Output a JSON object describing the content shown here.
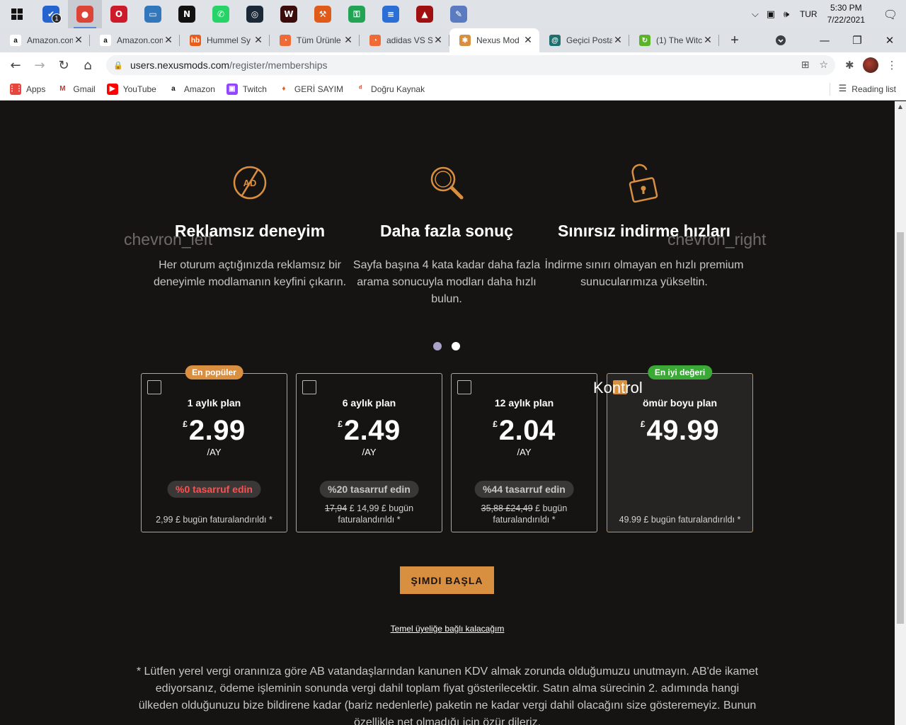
{
  "taskbar": {
    "apps": [
      {
        "name": "todo",
        "color": "#2564cf",
        "glyph": "✔",
        "badge": "1"
      },
      {
        "name": "chrome",
        "color": "#db4437",
        "glyph": "●",
        "active": true
      },
      {
        "name": "opera",
        "color": "#cc1b2a",
        "glyph": "O"
      },
      {
        "name": "pc",
        "color": "#3277bc",
        "glyph": "▭"
      },
      {
        "name": "notion",
        "color": "#111111",
        "glyph": "N"
      },
      {
        "name": "whatsapp",
        "color": "#25d366",
        "glyph": "✆"
      },
      {
        "name": "steam",
        "color": "#1b2838",
        "glyph": "◎"
      },
      {
        "name": "witcher",
        "color": "#3a0c0c",
        "glyph": "W"
      },
      {
        "name": "tool",
        "color": "#e05a1a",
        "glyph": "⚒"
      },
      {
        "name": "vpn",
        "color": "#23a455",
        "glyph": "⚿"
      },
      {
        "name": "docs",
        "color": "#2b6fd6",
        "glyph": "≡"
      },
      {
        "name": "game",
        "color": "#a01010",
        "glyph": "▲"
      },
      {
        "name": "paint",
        "color": "#5a7bc0",
        "glyph": "✎"
      }
    ],
    "language": "TUR",
    "time": "5:30 PM",
    "date": "7/22/2021"
  },
  "tabs": [
    {
      "title": "Amazon.com",
      "fav_color": "#ffffff",
      "fav_text": "a",
      "fav_fg": "#111"
    },
    {
      "title": "Amazon.com",
      "fav_color": "#ffffff",
      "fav_text": "a",
      "fav_fg": "#111"
    },
    {
      "title": "Hummel Sy",
      "fav_color": "#e85d1c",
      "fav_text": "hb",
      "fav_fg": "#fff"
    },
    {
      "title": "Tüm Ürünle",
      "fav_color": "#f06a35",
      "fav_text": "◔",
      "fav_fg": "#fff"
    },
    {
      "title": "adidas VS S",
      "fav_color": "#f06a35",
      "fav_text": "◔",
      "fav_fg": "#fff"
    },
    {
      "title": "Nexus Mod",
      "fav_color": "#d98f40",
      "fav_text": "✱",
      "fav_fg": "#fff",
      "active": true
    },
    {
      "title": "Geçici Posta",
      "fav_color": "#1f6f6f",
      "fav_text": "@",
      "fav_fg": "#fff"
    },
    {
      "title": "(1) The Witc",
      "fav_color": "#5bb32a",
      "fav_text": "↻",
      "fav_fg": "#fff"
    }
  ],
  "address": {
    "host": "users.nexusmods.com",
    "path": "/register/memberships"
  },
  "bookmarks": [
    {
      "label": "Apps",
      "color": "#e8453c",
      "glyph": "⋮⋮"
    },
    {
      "label": "Gmail",
      "color": "#ffffff",
      "glyph": "M",
      "fg": "#d93025"
    },
    {
      "label": "YouTube",
      "color": "#ff0000",
      "glyph": "▶"
    },
    {
      "label": "Amazon",
      "color": "#ffffff",
      "glyph": "a",
      "fg": "#111"
    },
    {
      "label": "Twitch",
      "color": "#9146ff",
      "glyph": "▣"
    },
    {
      "label": "GERİ SAYIM",
      "color": "#ffffff",
      "glyph": "♦",
      "fg": "#e85d1c"
    },
    {
      "label": "Doğru Kaynak",
      "color": "#ffffff",
      "glyph": "ᵈ",
      "fg": "#c0392b"
    }
  ],
  "reading_list": "Reading list",
  "carousel": {
    "prev": "chevron_left",
    "next": "chevron_right",
    "features": [
      {
        "icon": "no-ads-icon",
        "title": "Reklamsız deneyim",
        "text": "Her oturum açtığınızda reklamsız bir deneyimle modlamanın keyfini çıkarın."
      },
      {
        "icon": "search-icon",
        "title": "Daha fazla sonuç",
        "text": "Sayfa başına 4 kata kadar daha fazla arama sonucuyla modları daha hızlı bulun."
      },
      {
        "icon": "unlock-icon",
        "title": "Sınırsız indirme hızları",
        "text": "İndirme sınırı olmayan en hızlı premium sunucularımıza yükseltin."
      }
    ],
    "active_dot": 0,
    "dot_count": 2
  },
  "plans": [
    {
      "badge": "En popüler",
      "badge_color": "#d98f40",
      "name": "1 aylık plan",
      "currency": "£",
      "price": "2.99",
      "period": "/AY",
      "save": "%0 tasarruf edin",
      "save_color": "#ff4f4f",
      "old": "",
      "billed": "2,99 £ bugün faturalandırıldı *",
      "checked": false
    },
    {
      "badge": "",
      "name": "6 aylık plan",
      "currency": "£",
      "price": "2.49",
      "period": "/AY",
      "save": "%20 tasarruf edin",
      "save_color": "#c6c6c6",
      "old": "17,94",
      "billed": "£ 14,99 £ bugün faturalandırıldı *",
      "checked": false
    },
    {
      "badge": "",
      "name": "12 aylık plan",
      "currency": "£",
      "price": "2.04",
      "period": "/AY",
      "save": "%44 tasarruf edin",
      "save_color": "#c6c6c6",
      "old": "35,88 £24,49",
      "billed": "£ bugün faturalandırıldı *",
      "checked": false
    },
    {
      "badge": "En iyi değeri",
      "badge_color": "#3aa935",
      "name": "ömür boyu plan",
      "currency": "£",
      "price": "49.99",
      "period": "",
      "save": "",
      "old": "",
      "billed": "49.99 £ bugün faturalandırıldı *",
      "checked": true
    }
  ],
  "checkbox_label": "Kontrol",
  "cta": "ŞIMDI BAŞLA",
  "basic_link": "Temel üyeliğe bağlı kalacağım",
  "footnote": "* Lütfen yerel vergi oranınıza göre AB vatandaşlarından kanunen KDV almak zorunda olduğumuzu unutmayın. AB'de ikamet ediyorsanız, ödeme işleminin sonunda vergi dahil toplam fiyat gösterilecektir. Satın alma sürecinin 2. adımında hangi ülkeden olduğunuzu bize bildirene kadar (bariz nedenlerle) paketin ne kadar vergi dahil olacağını size gösteremeyiz. Bunun özellikle net olmadığı için özür dileriz.",
  "colors": {
    "accent": "#d98f40",
    "dot_active": "#a9a3c8",
    "dot_inactive": "#ffffff"
  }
}
